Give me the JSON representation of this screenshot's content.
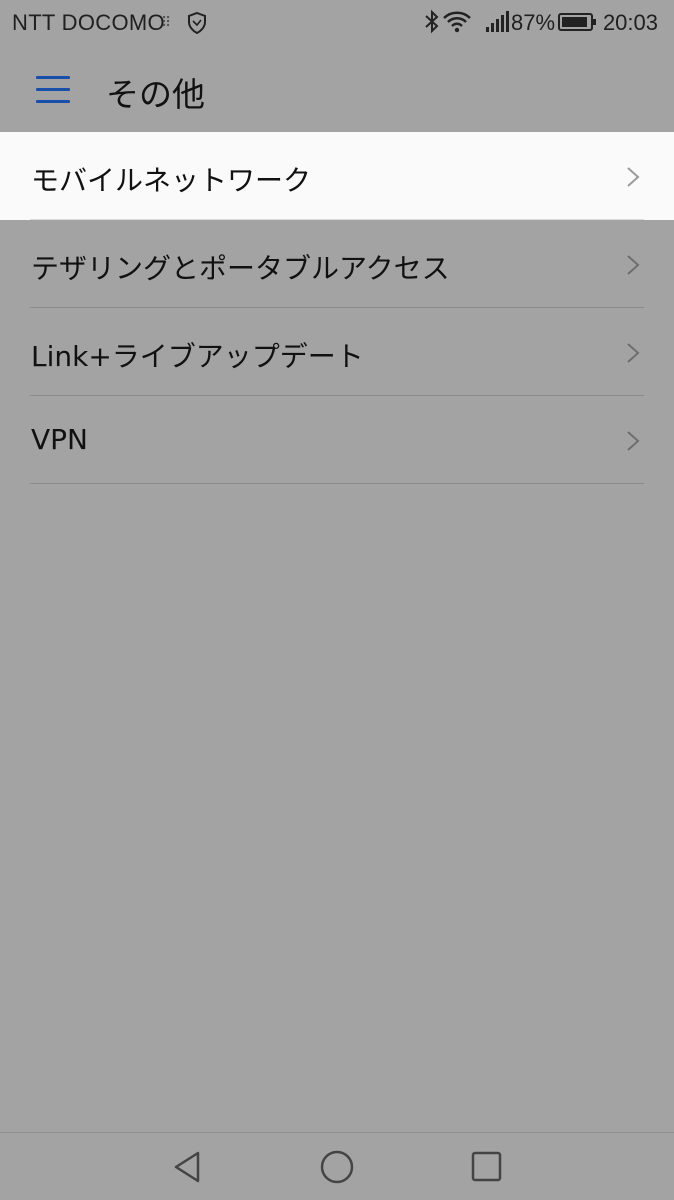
{
  "status_bar": {
    "carrier": "NTT DOCOMO",
    "battery_percent": "87%",
    "time": "20:03",
    "icons": [
      "sim-icon",
      "shield-icon",
      "bluetooth-icon",
      "wifi-icon",
      "signal-icon",
      "battery-icon"
    ]
  },
  "app_bar": {
    "title": "その他",
    "menu_icon": "hamburger-menu-icon"
  },
  "list": {
    "items": [
      {
        "label": "モバイルネットワーク",
        "highlighted": true
      },
      {
        "label": "テザリングとポータブルアクセス",
        "highlighted": false
      },
      {
        "label": "Link+ライブアップデート",
        "highlighted": false
      },
      {
        "label": "VPN",
        "highlighted": false
      }
    ]
  },
  "nav_bar": {
    "buttons": [
      "back-icon",
      "home-icon",
      "recents-icon"
    ]
  },
  "colors": {
    "background": "#a3a3a3",
    "highlight": "#fafafa",
    "accent": "#1a4fa8"
  }
}
